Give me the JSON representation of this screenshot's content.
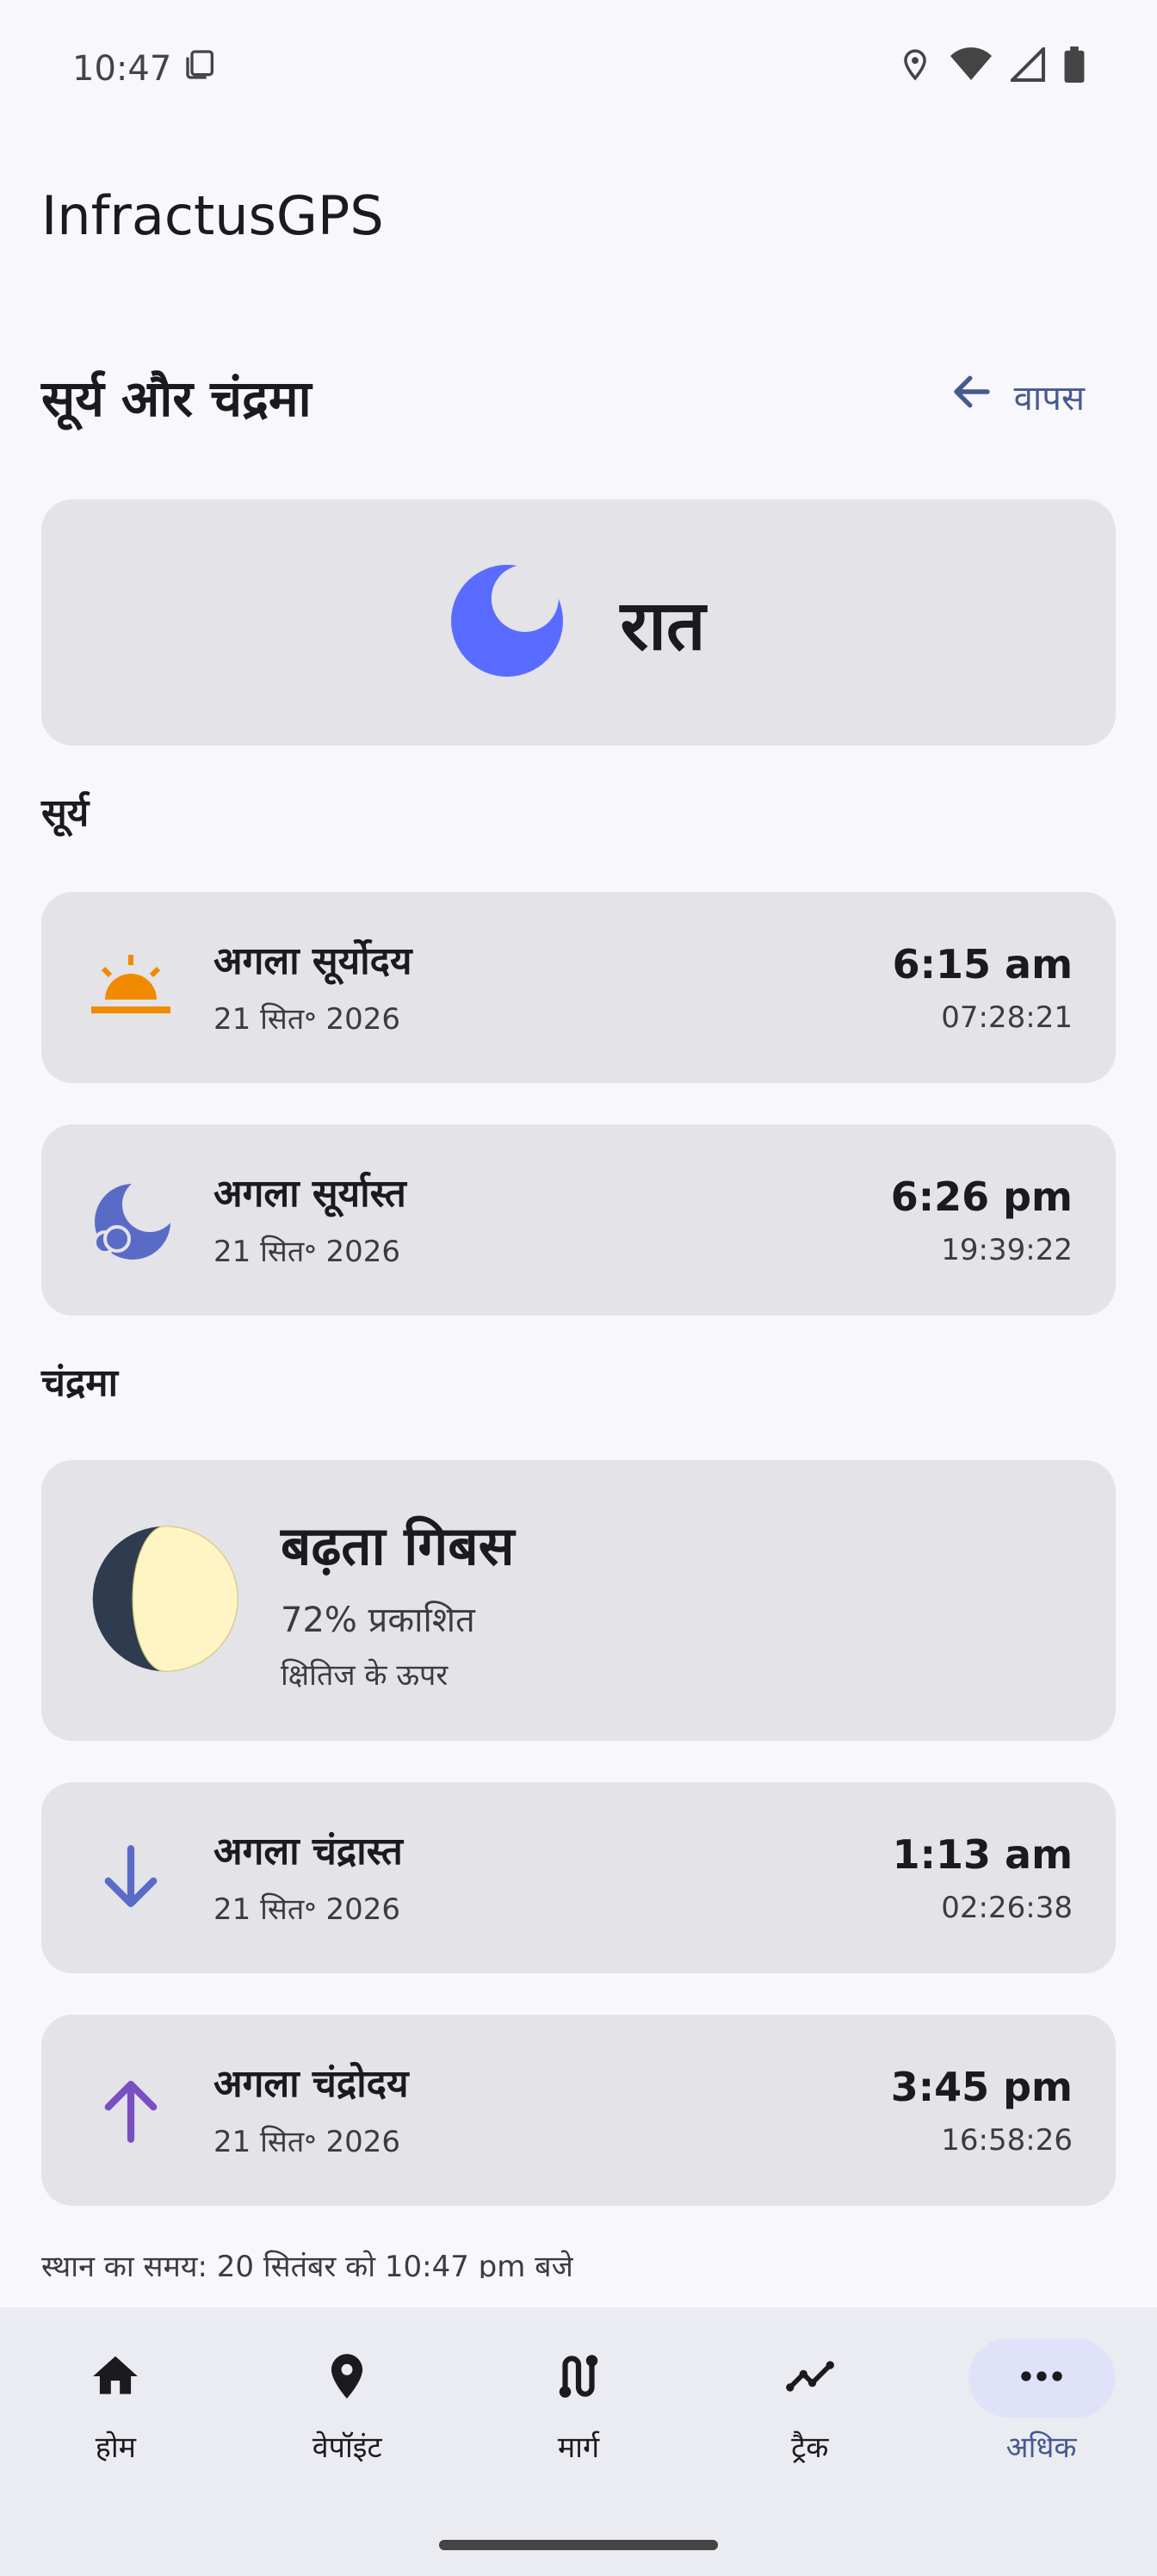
{
  "status_bar": {
    "time": "10:47"
  },
  "app": {
    "title": "InfractusGPS"
  },
  "header": {
    "title": "सूर्य और चंद्रमा",
    "back_label": "वापस"
  },
  "day_state": {
    "label": "रात",
    "icon": "moon-icon",
    "icon_color": "#5a6cff"
  },
  "sun": {
    "section_label": "सूर्य",
    "sunrise": {
      "title": "अगला सूर्योदय",
      "date": "21 सित॰ 2026",
      "time": "6:15 am",
      "time_24": "07:28:21",
      "icon": "sunrise-icon",
      "color": "#f28a00"
    },
    "sunset": {
      "title": "अगला सूर्यास्त",
      "date": "21 सित॰ 2026",
      "time": "6:26 pm",
      "time_24": "19:39:22",
      "icon": "moon-cloud-icon",
      "color": "#5a6bc7"
    }
  },
  "moon": {
    "section_label": "चंद्रमा",
    "phase": {
      "name": "बढ़ता गिबस",
      "illumination_text": "72% प्रकाशित",
      "illumination": 0.72,
      "horizon_text": "क्षितिज के ऊपर"
    },
    "moonset": {
      "title": "अगला चंद्रास्त",
      "date": "21 सित॰ 2026",
      "time": "1:13 am",
      "time_24": "02:26:38",
      "icon": "arrow-down-icon",
      "color": "#5a6bc7"
    },
    "moonrise": {
      "title": "अगला चंद्रोदय",
      "date": "21 सित॰ 2026",
      "time": "3:45 pm",
      "time_24": "16:58:26",
      "icon": "arrow-up-icon",
      "color": "#7a4fc2"
    }
  },
  "footer_note": "स्थान का समय: 20 सितंबर को 10:47 pm बजे",
  "nav": {
    "items": [
      {
        "label": "होम",
        "icon": "home-icon"
      },
      {
        "label": "वेपॉइंट",
        "icon": "location-pin-icon"
      },
      {
        "label": "मार्ग",
        "icon": "route-icon"
      },
      {
        "label": "ट्रैक",
        "icon": "track-icon"
      },
      {
        "label": "अधिक",
        "icon": "more-icon",
        "active": true
      }
    ]
  }
}
